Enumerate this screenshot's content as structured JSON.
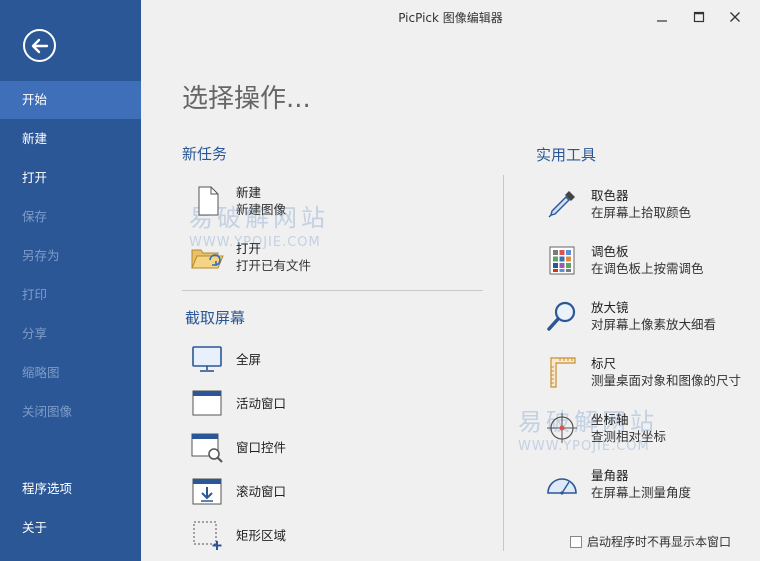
{
  "window": {
    "title": "PicPick 图像编辑器"
  },
  "sidebar": {
    "items": [
      {
        "label": "开始"
      },
      {
        "label": "新建"
      },
      {
        "label": "打开"
      },
      {
        "label": "保存"
      },
      {
        "label": "另存为"
      },
      {
        "label": "打印"
      },
      {
        "label": "分享"
      },
      {
        "label": "缩略图"
      },
      {
        "label": "关闭图像"
      },
      {
        "label": "程序选项"
      },
      {
        "label": "关于"
      }
    ]
  },
  "main": {
    "heading": "选择操作...",
    "new_task": {
      "title": "新任务",
      "items": [
        {
          "title": "新建",
          "desc": "新建图像"
        },
        {
          "title": "打开",
          "desc": "打开已有文件"
        }
      ]
    },
    "capture": {
      "title": "截取屏幕",
      "items": [
        {
          "title": "全屏"
        },
        {
          "title": "活动窗口"
        },
        {
          "title": "窗口控件"
        },
        {
          "title": "滚动窗口"
        },
        {
          "title": "矩形区域"
        }
      ]
    },
    "tools": {
      "title": "实用工具",
      "items": [
        {
          "title": "取色器",
          "desc": "在屏幕上拾取颜色"
        },
        {
          "title": "调色板",
          "desc": "在调色板上按需调色"
        },
        {
          "title": "放大镜",
          "desc": "对屏幕上像素放大细看"
        },
        {
          "title": "标尺",
          "desc": "测量桌面对象和图像的尺寸"
        },
        {
          "title": "坐标轴",
          "desc": "查测相对坐标"
        },
        {
          "title": "量角器",
          "desc": "在屏幕上测量角度"
        }
      ]
    },
    "footer_checkbox": "启动程序时不再显示本窗口"
  },
  "watermarks": [
    {
      "cn": "易破解网站",
      "en": "WWW.YPOJIE.COM"
    },
    {
      "cn": "易破解网站",
      "en": "WWW.YPOJIE.COM"
    }
  ]
}
